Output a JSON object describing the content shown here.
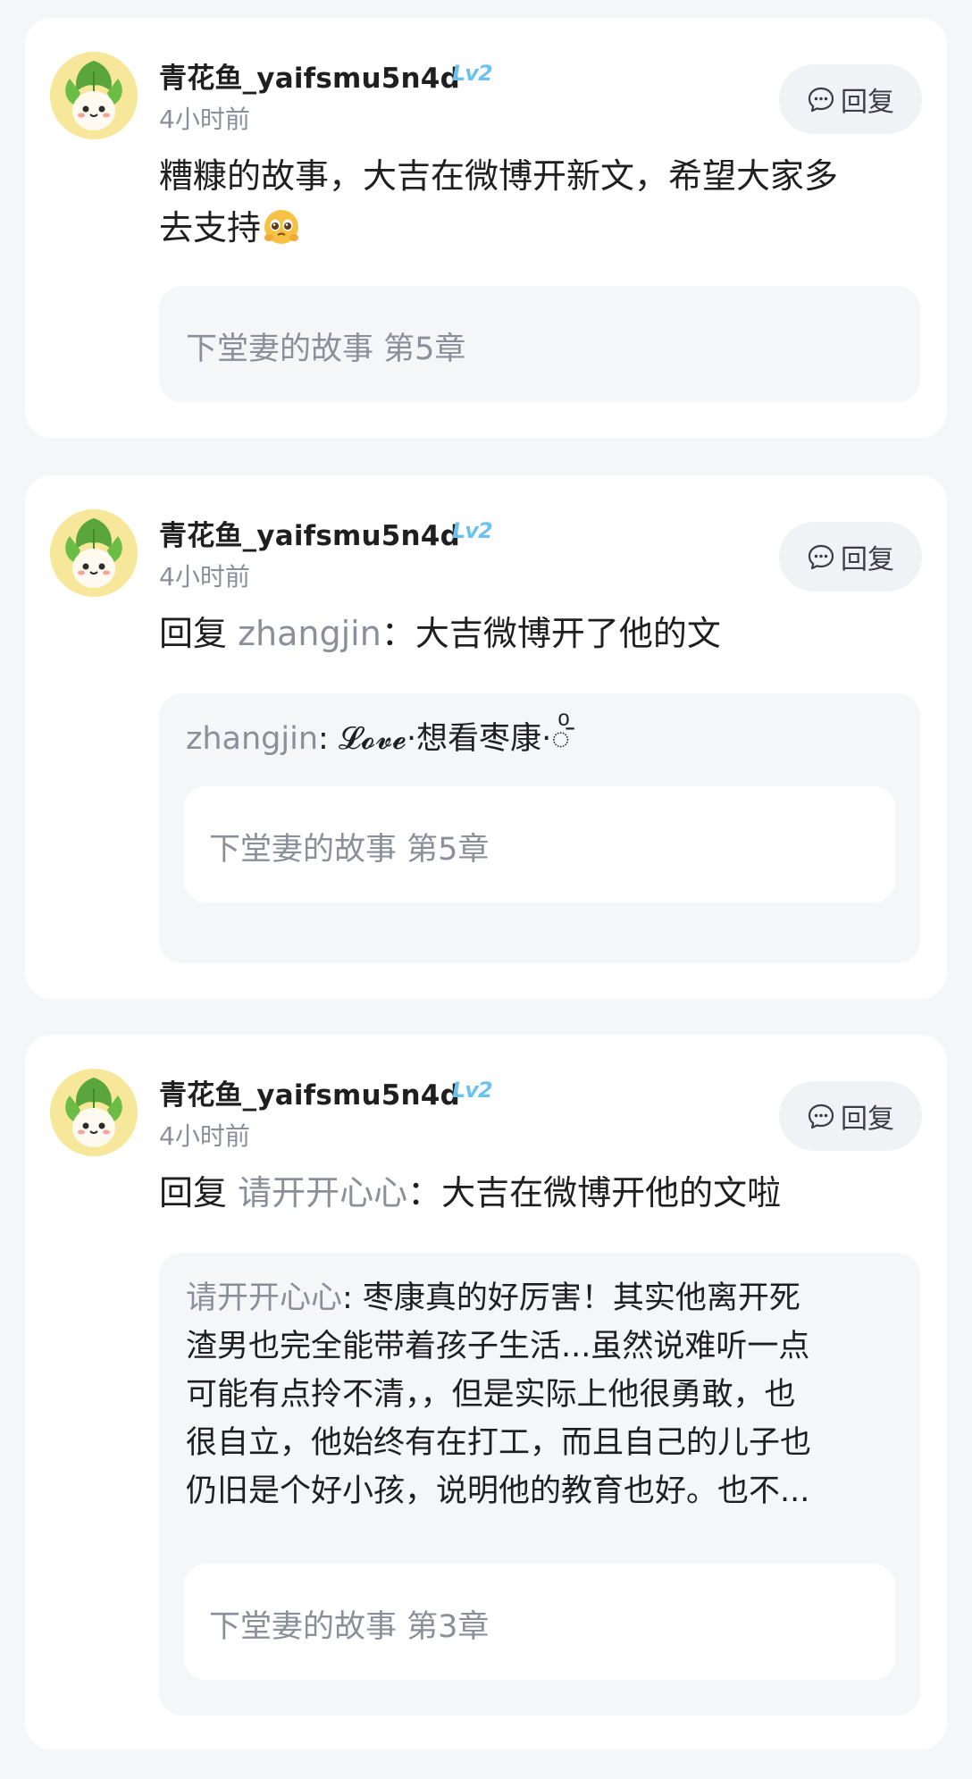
{
  "comments": [
    {
      "username": "青花鱼_yaifsmu5n4d",
      "level": "Lv2",
      "time": "4小时前",
      "reply_label": "回复",
      "content_line1": "糟糠的故事，大吉在微博开新文，希望大家多",
      "content_line2": "去支持",
      "emoji": "pleading-face-emoji",
      "ref_title": "下堂妻的故事 第5章"
    },
    {
      "username": "青花鱼_yaifsmu5n4d",
      "level": "Lv2",
      "time": "4小时前",
      "reply_label": "回复",
      "reply_prefix": "回复 ",
      "reply_to": "zhangjin",
      "reply_text": "：大吉微博开了他的文",
      "quote_name": "zhangjin",
      "quote_text": ": 𝓛𝓸𝓿𝓮·想看枣康·",
      "quote_decor": "◌ͦ̄",
      "ref_title": "下堂妻的故事 第5章"
    },
    {
      "username": "青花鱼_yaifsmu5n4d",
      "level": "Lv2",
      "time": "4小时前",
      "reply_label": "回复",
      "reply_prefix": "回复 ",
      "reply_to": "请开开心心",
      "reply_text": "：大吉在微博开他的文啦",
      "quote_name": "请开开心心",
      "quote_line1": ": 枣康真的好厉害！其实他离开死",
      "quote_line2": "渣男也完全能带着孩子生活...虽然说难听一点",
      "quote_line3": "可能有点拎不清，，但是实际上他很勇敢，也",
      "quote_line4": "很自立，他始终有在打工，而且自己的儿子也",
      "quote_line5": "仍旧是个好小孩，说明他的教育也好。也不...",
      "ref_title": "下堂妻的故事 第3章"
    }
  ],
  "colors": {
    "background": "#f5f6f8",
    "card": "#ffffff",
    "muted_text": "#8a8f99",
    "level_badge": "#6cc2ef",
    "avatar_bg": "#f7e79a"
  }
}
